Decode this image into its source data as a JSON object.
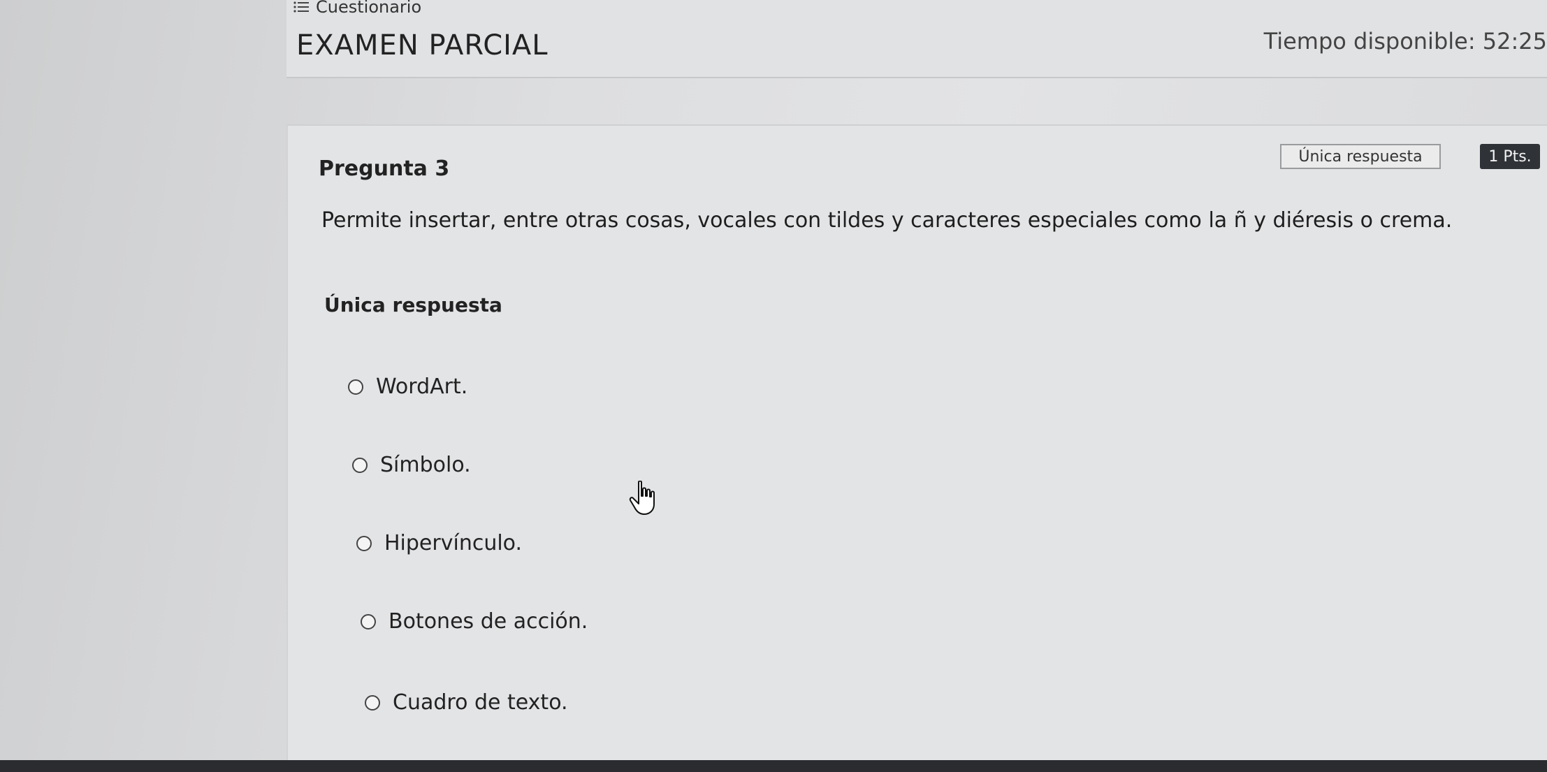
{
  "header": {
    "breadcrumb_icon": "list-icon",
    "breadcrumb_label": "Cuestionario",
    "exam_title": "EXAMEN PARCIAL",
    "timer_text": "Tiempo disponible: 52:25"
  },
  "question": {
    "number_label": "Pregunta 3",
    "type_badge": "Única respuesta",
    "points_badge": "1 Pts.",
    "text": "Permite insertar, entre otras cosas, vocales con tildes y caracteres especiales como la ñ y diéresis o crema.",
    "answer_heading": "Única respuesta",
    "options": [
      {
        "label": "WordArt."
      },
      {
        "label": "Símbolo."
      },
      {
        "label": "Hipervínculo."
      },
      {
        "label": "Botones de acción."
      },
      {
        "label": "Cuadro de texto."
      }
    ]
  },
  "colors": {
    "points_badge_bg": "#2f3338",
    "page_bg": "#dddee0"
  }
}
